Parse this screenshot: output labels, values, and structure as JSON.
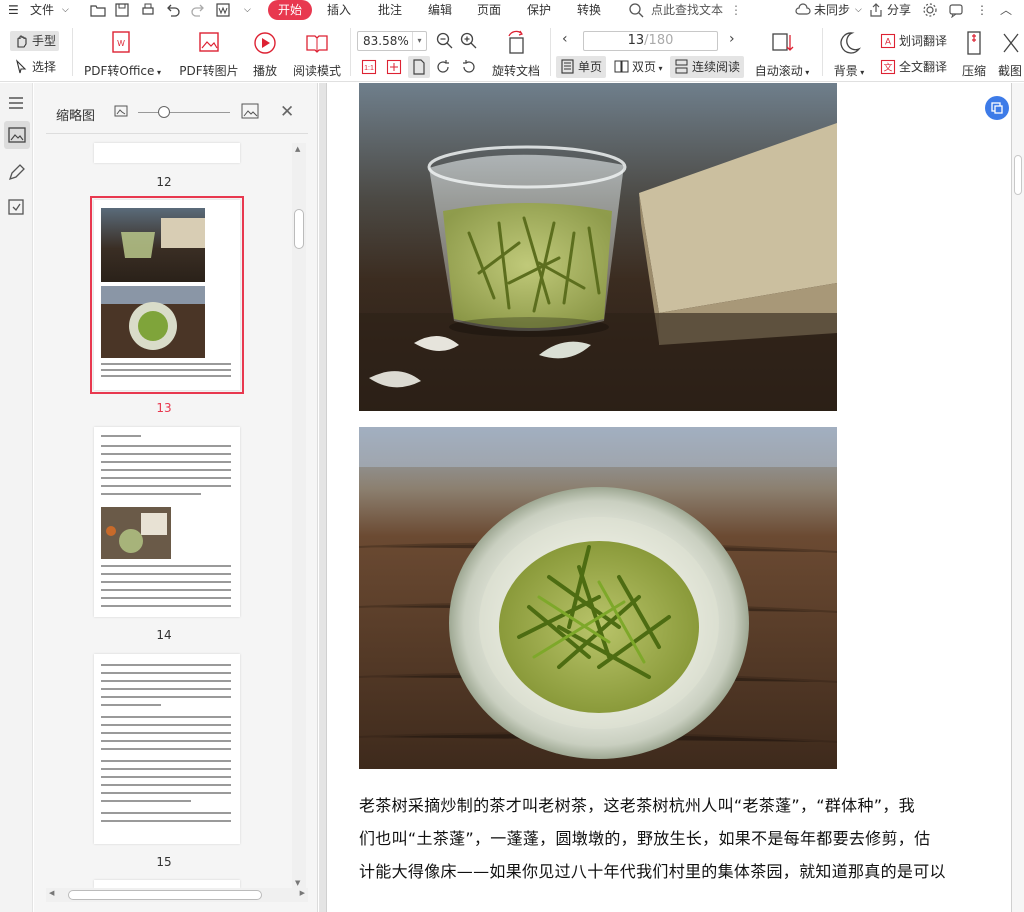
{
  "menubar": {
    "file_label": "文件",
    "tabs": [
      "开始",
      "插入",
      "批注",
      "编辑",
      "页面",
      "保护",
      "转换"
    ],
    "active_tab": "开始",
    "search_label": "点此查找文本",
    "sync_label": "未同步",
    "share_label": "分享"
  },
  "toolbar": {
    "hand_label": "手型",
    "select_label": "选择",
    "pdf_to_office": "PDF转Office",
    "pdf_to_image": "PDF转图片",
    "play": "播放",
    "read_mode": "阅读模式",
    "zoom_value": "83.58%",
    "rotate_doc": "旋转文档",
    "page_current": "13",
    "page_total": "/180",
    "single_page": "单页",
    "double_page": "双页",
    "continuous": "连续阅读",
    "auto_scroll": "自动滚动",
    "background": "背景",
    "word_translate": "划词翻译",
    "full_translate": "全文翻译",
    "compress": "压缩",
    "screenshot": "截图"
  },
  "panel": {
    "title": "缩略图",
    "pages": [
      "12",
      "13",
      "14",
      "15"
    ],
    "selected_page": "13"
  },
  "document": {
    "paragraph_lines": [
      "老茶树采摘炒制的茶才叫老树茶，这老茶树杭州人叫“老茶蓬”，“群体种”，我",
      "们也叫“土茶蓬”，一蓬蓬，圆墩墩的，野放生长，如果不是每年都要去修剪，估",
      "计能大得像床——如果你见过八十年代我们村里的集体茶园，就知道那真的是可以"
    ]
  },
  "colors": {
    "accent": "#e8384f",
    "float_button": "#3d7be8"
  }
}
